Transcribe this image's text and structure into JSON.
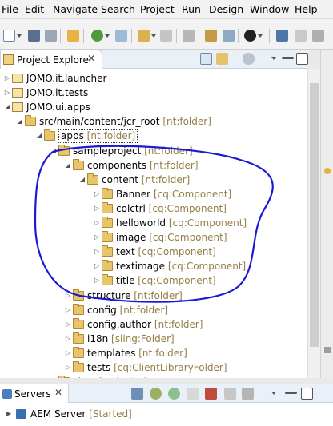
{
  "menu": {
    "items": [
      {
        "label": "File"
      },
      {
        "label": "Edit"
      },
      {
        "label": "Navigate"
      },
      {
        "label": "Search"
      },
      {
        "label": "Project"
      },
      {
        "label": "Run"
      },
      {
        "label": "Design"
      },
      {
        "label": "Window"
      },
      {
        "label": "Help"
      }
    ]
  },
  "project_explorer": {
    "tab_title": "Project Explorer",
    "close_glyph": "✕",
    "tree": [
      {
        "label": "JOMO.it.launcher",
        "decoration": "",
        "icon": "project-icon",
        "expanded": false
      },
      {
        "label": "JOMO.it.tests",
        "decoration": "",
        "icon": "project-icon",
        "expanded": false
      },
      {
        "label": "JOMO.ui.apps",
        "decoration": "",
        "icon": "project-icon",
        "expanded": true
      },
      {
        "label": "src/main/content/jcr_root",
        "decoration": "[nt:folder]",
        "icon": "folder-icon",
        "expanded": true
      },
      {
        "label": "apps",
        "decoration": "[nt:folder]",
        "icon": "folder-icon",
        "expanded": true
      },
      {
        "label": "sampleproject",
        "decoration": "[nt:folder]",
        "icon": "folder-icon",
        "expanded": true
      },
      {
        "label": "components",
        "decoration": "[nt:folder]",
        "icon": "folder-icon",
        "expanded": true
      },
      {
        "label": "content",
        "decoration": "[nt:folder]",
        "icon": "folder-icon",
        "expanded": true
      },
      {
        "label": "Banner",
        "decoration": "[cq:Component]",
        "icon": "folder-icon",
        "expanded": false
      },
      {
        "label": "colctrl",
        "decoration": "[cq:Component]",
        "icon": "folder-icon",
        "expanded": false
      },
      {
        "label": "helloworld",
        "decoration": "[cq:Component]",
        "icon": "folder-icon",
        "expanded": false
      },
      {
        "label": "image",
        "decoration": "[cq:Component]",
        "icon": "folder-icon",
        "expanded": false
      },
      {
        "label": "text",
        "decoration": "[cq:Component]",
        "icon": "folder-icon",
        "expanded": false
      },
      {
        "label": "textimage",
        "decoration": "[cq:Component]",
        "icon": "folder-icon",
        "expanded": false
      },
      {
        "label": "title",
        "decoration": "[cq:Component]",
        "icon": "folder-icon",
        "expanded": false
      },
      {
        "label": "structure",
        "decoration": "[nt:folder]",
        "icon": "folder-icon",
        "expanded": false
      },
      {
        "label": "config",
        "decoration": "[nt:folder]",
        "icon": "folder-icon",
        "expanded": false
      },
      {
        "label": "config.author",
        "decoration": "[nt:folder]",
        "icon": "folder-icon",
        "expanded": false
      },
      {
        "label": "i18n",
        "decoration": "[sling:Folder]",
        "icon": "folder-icon",
        "expanded": false
      },
      {
        "label": "templates",
        "decoration": "[nt:folder]",
        "icon": "folder-icon",
        "expanded": false
      },
      {
        "label": "tests",
        "decoration": "[cq:ClientLibraryFolder]",
        "icon": "folder-icon",
        "expanded": false
      },
      {
        "label": "clien",
        "decoration": "[nt:folder]",
        "icon": "folder-icon",
        "expanded": false
      }
    ]
  },
  "servers": {
    "tab_title": "Servers",
    "close_glyph": "✕",
    "server_name": "AEM Server",
    "server_status": "[Started]"
  },
  "colors": {
    "decoration": "#957d47",
    "annotation_ink": "#1a1ad4",
    "selection_border": "#333333"
  }
}
